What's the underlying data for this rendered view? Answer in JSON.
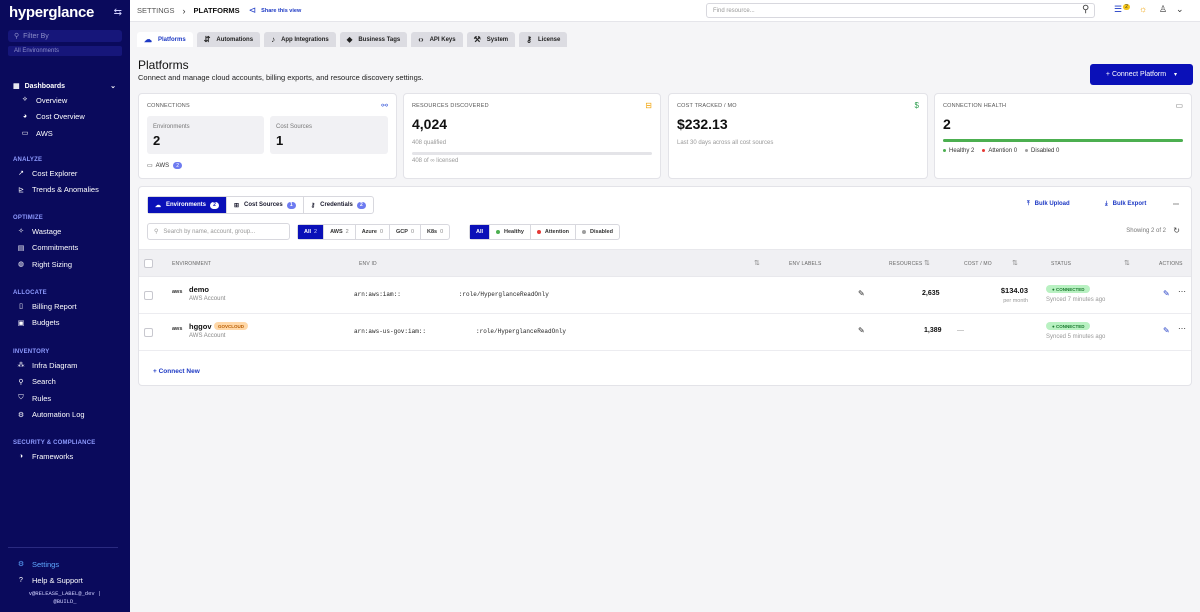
{
  "sidebar": {
    "logo": "hyperglance",
    "filter_placeholder": "Filter By",
    "env_placeholder": "All Environments",
    "dashboards": {
      "label": "Dashboards",
      "items": [
        "Overview",
        "Cost Overview",
        "AWS"
      ]
    },
    "sections": [
      {
        "title": "ANALYZE",
        "items": [
          "Cost Explorer",
          "Trends & Anomalies"
        ]
      },
      {
        "title": "OPTIMIZE",
        "items": [
          "Wastage",
          "Commitments",
          "Right Sizing"
        ]
      },
      {
        "title": "ALLOCATE",
        "items": [
          "Billing Report",
          "Budgets"
        ]
      },
      {
        "title": "INVENTORY",
        "items": [
          "Infra Diagram",
          "Search",
          "Rules",
          "Automation Log"
        ]
      },
      {
        "title": "SECURITY & COMPLIANCE",
        "items": [
          "Frameworks"
        ]
      }
    ],
    "footer": {
      "settings": "Settings",
      "help": "Help & Support",
      "version_line1": "v@RELEASE_LABEL@_dev |",
      "version_line2": "@BUILD_"
    }
  },
  "topbar": {
    "crumb1": "SETTINGS",
    "crumb2": "PLATFORMS",
    "share": "Share this view",
    "find_placeholder": "Find resource...",
    "notif_count": "2"
  },
  "tabs": [
    "Platforms",
    "Automations",
    "App Integrations",
    "Business Tags",
    "API Keys",
    "System",
    "License"
  ],
  "page": {
    "title": "Platforms",
    "subtitle": "Connect and manage cloud accounts, billing exports, and resource discovery settings.",
    "connect_btn": "+ Connect Platform"
  },
  "cards": {
    "connections": {
      "title": "CONNECTIONS",
      "env_label": "Environments",
      "env_value": "2",
      "cost_label": "Cost Sources",
      "cost_value": "1",
      "aws_label": "AWS",
      "aws_count": "2"
    },
    "resources": {
      "title": "RESOURCES DISCOVERED",
      "value": "4,024",
      "qualified": "408 qualified",
      "licensed": "408 of ∞ licensed"
    },
    "cost": {
      "title": "COST TRACKED / MO",
      "value": "$232.13",
      "note": "Last 30 days across all cost sources"
    },
    "health": {
      "title": "CONNECTION HEALTH",
      "value": "2",
      "healthy": "Healthy 2",
      "attention": "Attention 0",
      "disabled": "Disabled 0",
      "healthy_fraction": 1.0
    }
  },
  "panel": {
    "segments": [
      {
        "label": "Environments",
        "count": "2"
      },
      {
        "label": "Cost Sources",
        "count": "1"
      },
      {
        "label": "Credentials",
        "count": "2"
      }
    ],
    "bulk_upload": "Bulk Upload",
    "bulk_export": "Bulk Export",
    "search_placeholder": "Search by name, account, group...",
    "provider_filters": [
      {
        "label": "All",
        "count": "2"
      },
      {
        "label": "AWS",
        "count": "2"
      },
      {
        "label": "Azure",
        "count": "0"
      },
      {
        "label": "GCP",
        "count": "0"
      },
      {
        "label": "K8s",
        "count": "0"
      }
    ],
    "status_filters": [
      "All",
      "Healthy",
      "Attention",
      "Disabled"
    ],
    "showing": "Showing 2 of 2",
    "headers": {
      "environment": "ENVIRONMENT",
      "env_id": "ENV ID",
      "env_labels": "ENV LABELS",
      "resources": "RESOURCES",
      "cost": "COST / MO",
      "status": "STATUS",
      "actions": "ACTIONS"
    },
    "rows": [
      {
        "name": "demo",
        "type": "AWS Account",
        "badge": "",
        "arn_prefix": "arn:aws:iam::",
        "arn_suffix": ":role/HyperglanceReadOnly",
        "resources": "2,635",
        "cost": "$134.03",
        "cost_sub": "per month",
        "status": "● CONNECTED",
        "synced": "Synced 7 minutes ago"
      },
      {
        "name": "hggov",
        "type": "AWS Account",
        "badge": "GOVCLOUD",
        "arn_prefix": "arn:aws-us-gov:iam::",
        "arn_suffix": ":role/HyperglanceReadOnly",
        "resources": "1,389",
        "cost": "—",
        "cost_sub": "",
        "status": "● CONNECTED",
        "synced": "Synced 5 minutes ago"
      }
    ],
    "connect_new": "+ Connect New"
  },
  "colors": {
    "sidebar_bg": "#0a0a5c",
    "accent": "#0a10b8",
    "link": "#1d39c4",
    "healthy": "#4caf50",
    "attention": "#e53935",
    "disabled": "#9e9e9e"
  }
}
